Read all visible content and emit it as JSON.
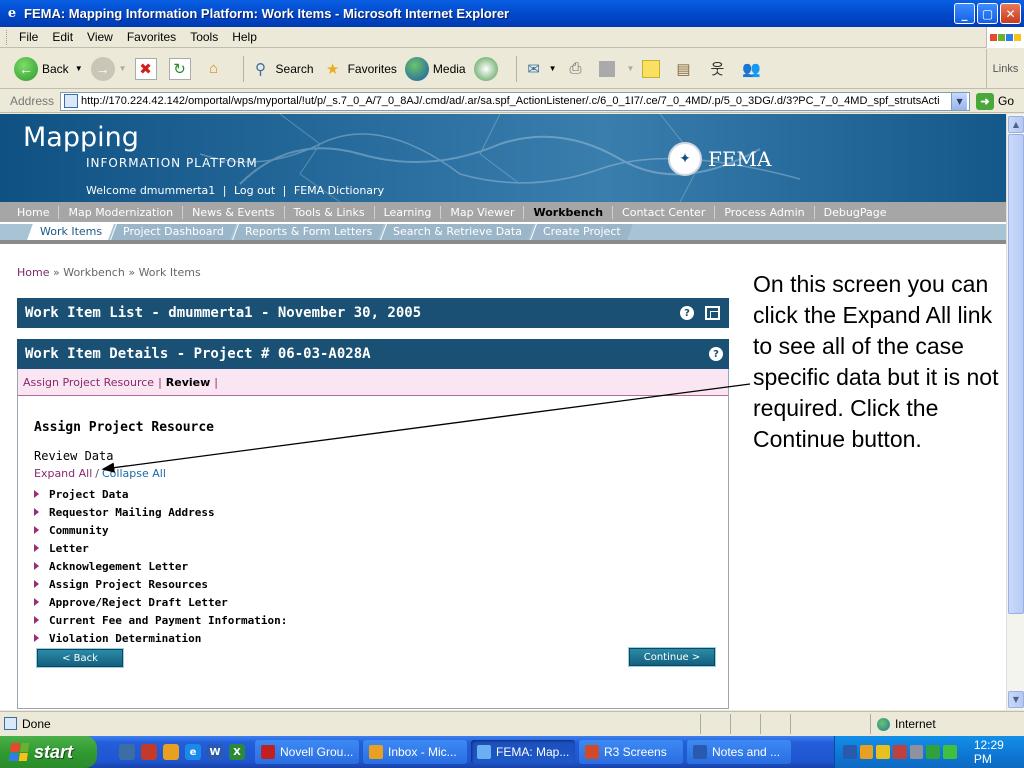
{
  "window": {
    "title": "FEMA: Mapping Information Platform: Work Items - Microsoft Internet Explorer",
    "min": "_",
    "max": "▢",
    "close": "✕"
  },
  "menu": [
    "File",
    "Edit",
    "View",
    "Favorites",
    "Tools",
    "Help"
  ],
  "toolbar": {
    "back": "Back",
    "search": "Search",
    "favorites": "Favorites",
    "media": "Media",
    "links": "Links"
  },
  "address": {
    "label": "Address",
    "url": "http://170.224.42.142/omportal/wps/myportal/!ut/p/_s.7_0_A/7_0_8AJ/.cmd/ad/.ar/sa.spf_ActionListener/.c/6_0_1I7/.ce/7_0_4MD/.p/5_0_3DG/.d/3?PC_7_0_4MD_spf_strutsActi",
    "go": "Go"
  },
  "site": {
    "brand_main": "Mapping",
    "brand_sub": "INFORMATION PLATFORM",
    "fema": "FEMA",
    "welcome": "Welcome dmummerta1",
    "logout": "Log out",
    "dictionary": "FEMA Dictionary",
    "sep": "|"
  },
  "nav_primary": [
    "Home",
    "Map Modernization",
    "News & Events",
    "Tools & Links",
    "Learning",
    "Map Viewer",
    "Workbench",
    "Contact Center",
    "Process Admin",
    "DebugPage"
  ],
  "nav_secondary": [
    "Work Items",
    "Project Dashboard",
    "Reports & Form Letters",
    "Search & Retrieve Data",
    "Create Project"
  ],
  "breadcrumb": {
    "home": "Home",
    "sep": "»",
    "workbench": "Workbench",
    "current": "Work Items"
  },
  "panel1": {
    "title": "Work Item List - dmummerta1 - November 30, 2005"
  },
  "panel2": {
    "title": "Work Item Details - Project # 06-03-A028A",
    "tab_assign": "Assign Project Resource",
    "tab_review": "Review",
    "pipe": "|"
  },
  "help_glyph": "?",
  "content": {
    "section_title": "Assign Project Resource",
    "review_label": "Review Data",
    "expand_all": "Expand All",
    "slash": "/",
    "collapse_all": "Collapse All",
    "sections": [
      "Project Data",
      "Requestor Mailing Address",
      "Community",
      "Letter",
      "Acknowlegement Letter",
      "Assign Project Resources",
      "Approve/Reject Draft Letter",
      "Current Fee and Payment Information:",
      "Violation Determination"
    ],
    "back_button": "< Back",
    "continue_button": "Continue >"
  },
  "annotation": "On this screen you can click the Expand All link to see all of the case specific data but it is not required. Click the Continue button.",
  "status": {
    "text": "Done",
    "zone": "Internet"
  },
  "taskbar": {
    "start": "start",
    "tasks": [
      "Novell Grou...",
      "Inbox - Mic...",
      "FEMA: Map...",
      "R3 Screens",
      "Notes and ..."
    ],
    "clock": "12:29 PM"
  },
  "colors": {
    "banner": "#1a5073",
    "accent_link": "#8b2a6e",
    "button": "#14607e"
  }
}
